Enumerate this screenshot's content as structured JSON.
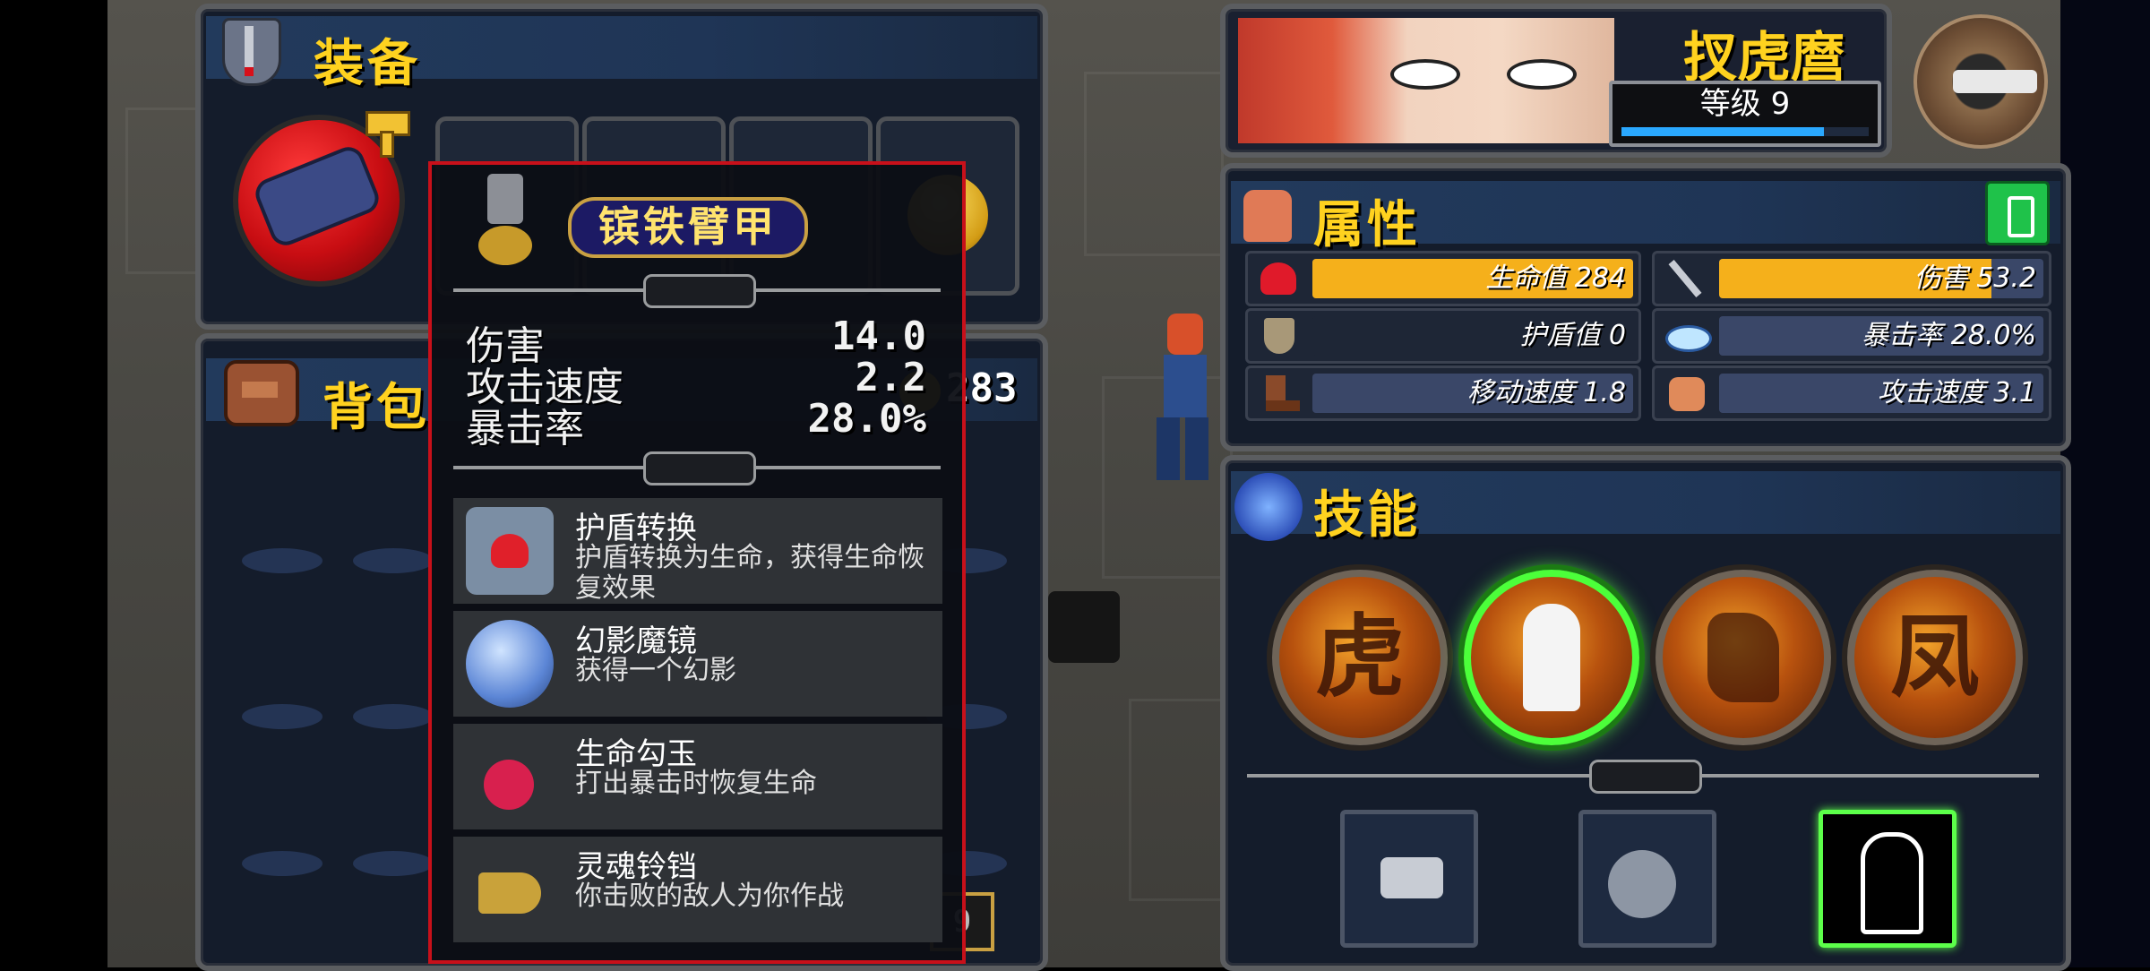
{
  "equipment": {
    "title": "装备",
    "item_counter": "283"
  },
  "backpack": {
    "title": "背包",
    "page_indicator": "9"
  },
  "tooltip": {
    "item_name": "镔铁臂甲",
    "stats": [
      {
        "label": "伤害",
        "value": "14.0"
      },
      {
        "label": "攻击速度",
        "value": "2.2"
      },
      {
        "label": "暴击率",
        "value": "28.0%"
      }
    ],
    "effects": [
      {
        "name": "护盾转换",
        "desc": "护盾转换为生命，获得生命恢复效果"
      },
      {
        "name": "幻影魔镜",
        "desc": "获得一个幻影"
      },
      {
        "name": "生命勾玉",
        "desc": "打出暴击时恢复生命"
      },
      {
        "name": "灵魂铃铛",
        "desc": "你击败的敌人为你作战"
      }
    ]
  },
  "character": {
    "name": "扠虎麿",
    "level_label": "等级 9",
    "xp_fraction": 0.82
  },
  "attributes": {
    "title": "属性",
    "rows": [
      {
        "label": "生命值 284",
        "fill": 1.0
      },
      {
        "label": "伤害 53.2",
        "fill": 0.84
      },
      {
        "label": "护盾值 0",
        "fill": 0.0
      },
      {
        "label": "暴击率 28.0%",
        "fill": 0.0
      },
      {
        "label": "移动速度 1.8",
        "fill": 0.0
      },
      {
        "label": "攻击速度 3.1",
        "fill": 0.0
      }
    ]
  },
  "skills": {
    "title": "技能",
    "orbs": [
      {
        "glyph": "虎"
      },
      {
        "glyph": "",
        "selected": true
      },
      {
        "glyph": ""
      },
      {
        "glyph": "凤"
      }
    ]
  },
  "colors": {
    "accent": "#ffd21f",
    "bar_fill": "#f5b01b",
    "tooltip_border": "#c8101a",
    "selected_glow": "#5cff4a"
  }
}
